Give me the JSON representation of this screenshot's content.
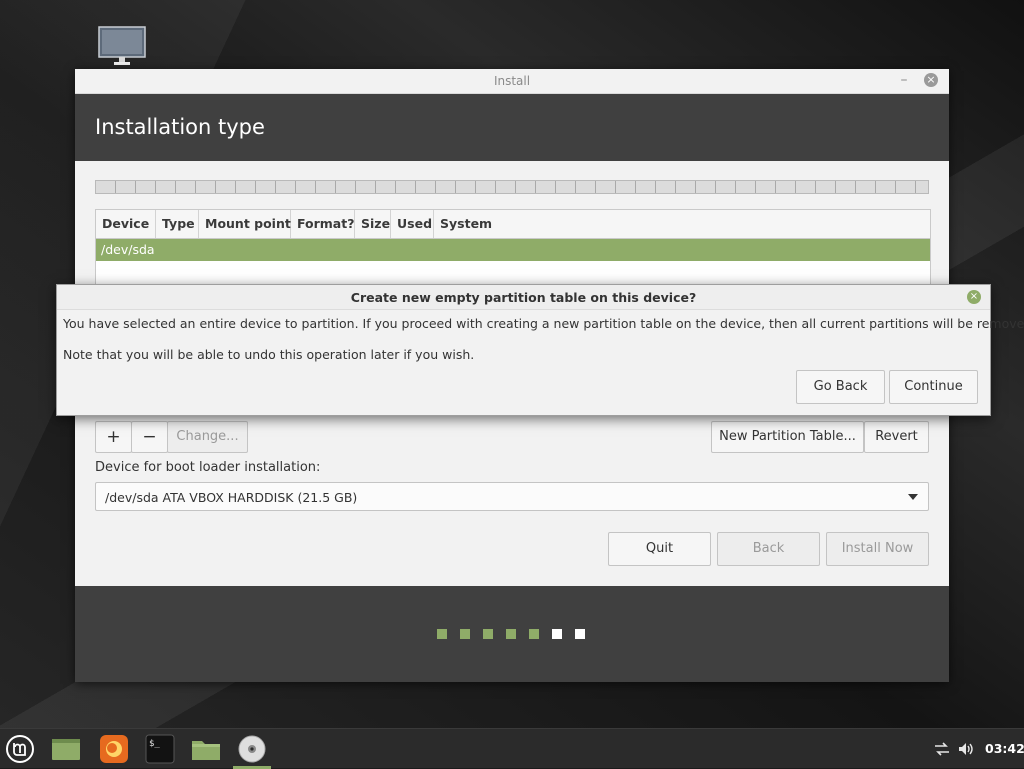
{
  "window": {
    "title": "Install",
    "minimize_glyph": "–",
    "close_glyph": "×",
    "page_title": "Installation type"
  },
  "table": {
    "columns": [
      "Device",
      "Type",
      "Mount point",
      "Format?",
      "Size",
      "Used",
      "System"
    ],
    "rows": [
      {
        "device": "/dev/sda"
      }
    ]
  },
  "partition_buttons": {
    "add": "+",
    "remove": "−",
    "change": "Change...",
    "new_table": "New Partition Table...",
    "revert": "Revert"
  },
  "bootloader": {
    "label": "Device for boot loader installation:",
    "selected": "/dev/sda ATA VBOX HARDDISK (21.5 GB)"
  },
  "nav_buttons": {
    "quit": "Quit",
    "back": "Back",
    "install_now": "Install Now"
  },
  "progress": {
    "total_steps": 7,
    "completed_steps": 5,
    "completed_color": "#8fac68",
    "pending_color": "#ffffff"
  },
  "dialog": {
    "title": "Create new empty partition table on this device?",
    "close_glyph": "×",
    "message": "You have selected an entire device to partition. If you proceed with creating a new partition table on the device, then all current partitions will be removed.",
    "note": "Note that you will be able to undo this operation later if you wish.",
    "go_back": "Go Back",
    "continue": "Continue"
  },
  "taskbar": {
    "clock": "03:42",
    "accent": "#8fac68",
    "icons": [
      "mint-menu-icon",
      "show-desktop-icon",
      "firefox-icon",
      "terminal-icon",
      "files-icon",
      "installer-disc-icon"
    ],
    "tray_icons": [
      "network-icon",
      "volume-icon"
    ]
  }
}
